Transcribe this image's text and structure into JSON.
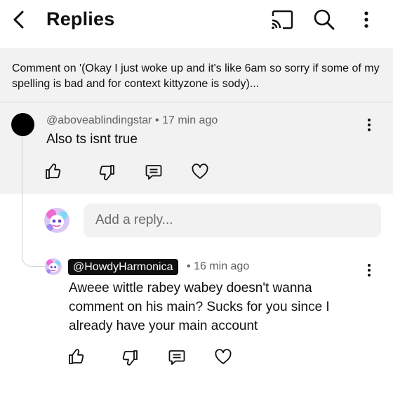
{
  "header": {
    "title": "Replies"
  },
  "context": {
    "text": "Comment on '(Okay I just woke up and it's like 6am so sorry if some of my spelling is bad and for context kittyzone is sody)..."
  },
  "parent_comment": {
    "handle": "@aboveablindingstar",
    "separator": "•",
    "time": "17 min ago",
    "body": "Also ts isnt true"
  },
  "reply_box": {
    "placeholder": "Add a reply..."
  },
  "reply_comment": {
    "handle": "@HowdyHarmonica",
    "separator": "•",
    "time": "16 min ago",
    "body": "Aweee wittle rabey wabey doesn't wanna comment on his main? Sucks for you since I already have your main account"
  },
  "colors": {
    "panel_bg": "#f2f2f2",
    "text": "#0f0f0f",
    "secondary_text": "#606060",
    "badge_bg": "#0f0f0f"
  }
}
